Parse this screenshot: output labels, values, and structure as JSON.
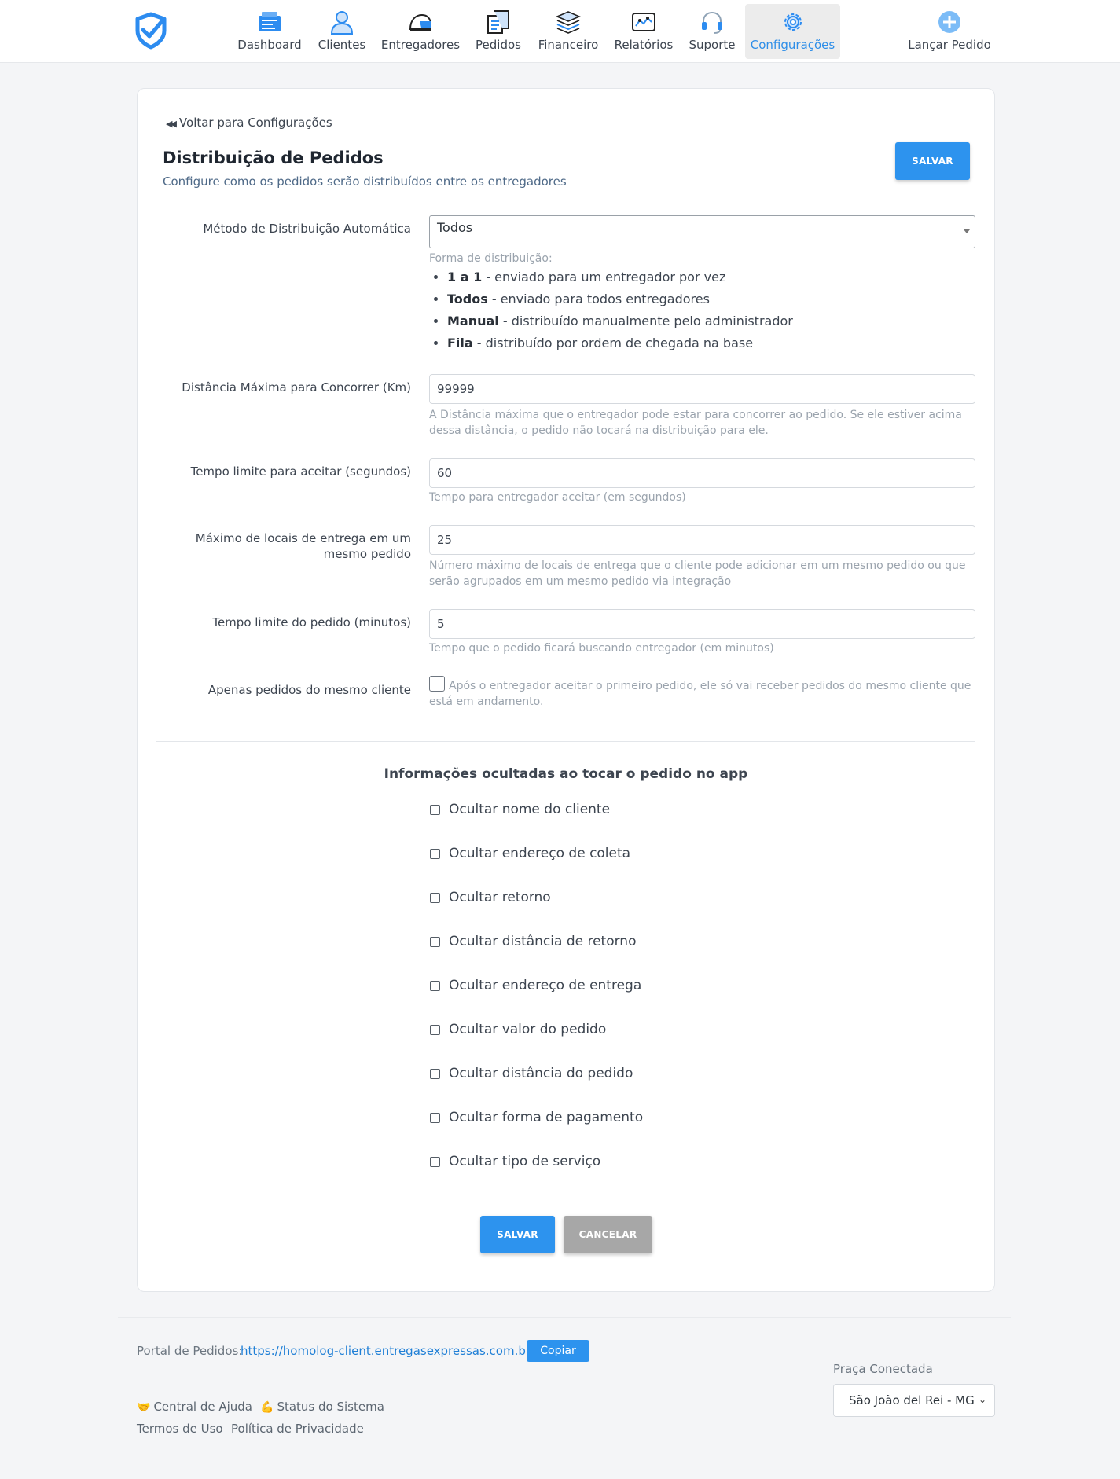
{
  "colors": {
    "accent": "#2d93ee",
    "active_nav_text": "#2e8ee8",
    "link": "#1f7fd6",
    "secondary_button": "#a7a7a7"
  },
  "nav": {
    "items": [
      {
        "label": "Dashboard",
        "icon": "dashboard-icon"
      },
      {
        "label": "Clientes",
        "icon": "user-icon"
      },
      {
        "label": "Entregadores",
        "icon": "helmet-icon"
      },
      {
        "label": "Pedidos",
        "icon": "receipt-icon"
      },
      {
        "label": "Financeiro",
        "icon": "money-stack-icon"
      },
      {
        "label": "Relatórios",
        "icon": "report-chart-icon"
      },
      {
        "label": "Suporte",
        "icon": "headset-icon"
      },
      {
        "label": "Configurações",
        "icon": "gear-icon",
        "active": true
      }
    ],
    "launch_order": {
      "label": "Lançar Pedido",
      "icon": "plus-circle-icon"
    }
  },
  "page": {
    "back_link": "Voltar para Configurações",
    "title": "Distribuição de Pedidos",
    "subtitle": "Configure como os pedidos serão distribuídos entre os entregadores",
    "save_label": "SALVAR",
    "cancel_label": "CANCELAR"
  },
  "form": {
    "method": {
      "label": "Método de Distribuição Automática",
      "value": "Todos",
      "help_title": "Forma de distribuição:",
      "options": [
        {
          "name": "1 a 1",
          "desc": " - enviado para um entregador por vez"
        },
        {
          "name": "Todos",
          "desc": " - enviado para todos entregadores"
        },
        {
          "name": "Manual",
          "desc": " - distribuído manualmente pelo administrador"
        },
        {
          "name": "Fila",
          "desc": " - distribuído por ordem de chegada na base"
        }
      ]
    },
    "max_distance": {
      "label": "Distância Máxima para Concorrer (Km)",
      "value": "99999",
      "help": "A Distância máxima que o entregador pode estar para concorrer ao pedido. Se ele estiver acima dessa distância, o pedido não tocará na distribuição para ele."
    },
    "accept_time": {
      "label": "Tempo limite para aceitar (segundos)",
      "value": "60",
      "help": "Tempo para entregador aceitar (em segundos)"
    },
    "max_locations": {
      "label": "Máximo de locais de entrega em um mesmo pedido",
      "value": "25",
      "help": "Número máximo de locais de entrega que o cliente pode adicionar em um mesmo pedido ou que serão agrupados em um mesmo pedido via integração"
    },
    "order_time": {
      "label": "Tempo limite do pedido (minutos)",
      "value": "5",
      "help": "Tempo que o pedido ficará buscando entregador (em minutos)"
    },
    "same_client": {
      "label": "Apenas pedidos do mesmo cliente",
      "checked": false,
      "help": "Após o entregador aceitar o primeiro pedido, ele só vai receber pedidos do mesmo cliente que está em andamento."
    }
  },
  "hidden_info": {
    "title": "Informações ocultadas ao tocar o pedido no app",
    "options": [
      {
        "label": "Ocultar nome do cliente",
        "checked": false
      },
      {
        "label": "Ocultar endereço de coleta",
        "checked": false
      },
      {
        "label": "Ocultar retorno",
        "checked": false
      },
      {
        "label": "Ocultar distância de retorno",
        "checked": false
      },
      {
        "label": "Ocultar endereço de entrega",
        "checked": false
      },
      {
        "label": "Ocultar valor do pedido",
        "checked": false
      },
      {
        "label": "Ocultar distância do pedido",
        "checked": false
      },
      {
        "label": "Ocultar forma de pagamento",
        "checked": false
      },
      {
        "label": "Ocultar tipo de serviço",
        "checked": false
      }
    ]
  },
  "footer": {
    "portal_label": "Portal de Pedidos:",
    "portal_url": "https://homolog-client.entregasexpressas.com.br",
    "copy_label": "Copiar",
    "help_center": "Central de Ajuda",
    "help_center_emoji": "🤝",
    "system_status": "Status do Sistema",
    "system_status_emoji": "💪",
    "terms": "Termos de Uso",
    "privacy": "Política de Privacidade",
    "praca_label": "Praça Conectada",
    "praca_value": "São João del Rei - MG"
  }
}
